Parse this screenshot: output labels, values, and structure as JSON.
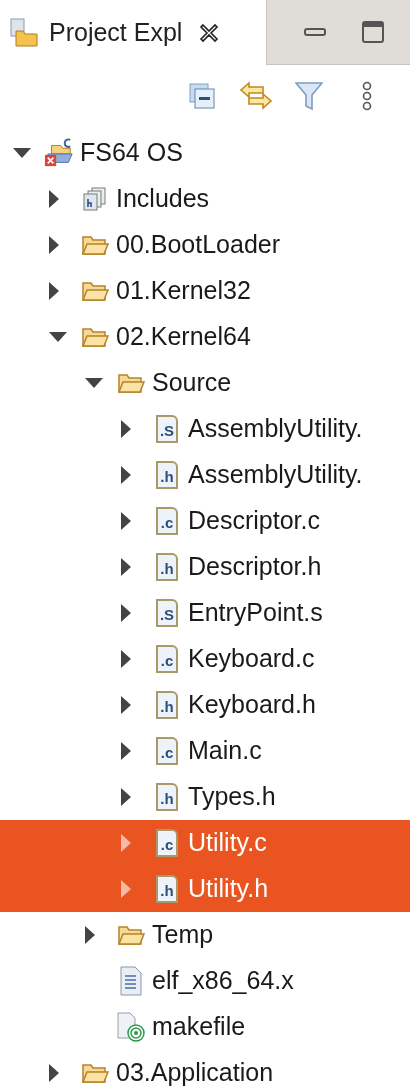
{
  "view_tab": {
    "title": "Project Expl",
    "selected": true
  },
  "tree": [
    {
      "label": "FS64 OS",
      "kind": "project",
      "expanded": true,
      "selected": false,
      "children": [
        {
          "label": "Includes",
          "kind": "includes",
          "expanded": false,
          "selected": false
        },
        {
          "label": "00.BootLoader",
          "kind": "folder",
          "expanded": false,
          "selected": false
        },
        {
          "label": "01.Kernel32",
          "kind": "folder",
          "expanded": false,
          "selected": false
        },
        {
          "label": "02.Kernel64",
          "kind": "folder",
          "expanded": true,
          "selected": false,
          "children": [
            {
              "label": "Source",
              "kind": "folder",
              "expanded": true,
              "selected": false,
              "children": [
                {
                  "label": "AssemblyUtility.",
                  "kind": "source",
                  "badge": ".S",
                  "expanded": false,
                  "selected": false
                },
                {
                  "label": "AssemblyUtility.",
                  "kind": "source",
                  "badge": ".h",
                  "expanded": false,
                  "selected": false
                },
                {
                  "label": "Descriptor.c",
                  "kind": "source",
                  "badge": ".c",
                  "expanded": false,
                  "selected": false
                },
                {
                  "label": "Descriptor.h",
                  "kind": "source",
                  "badge": ".h",
                  "expanded": false,
                  "selected": false
                },
                {
                  "label": "EntryPoint.s",
                  "kind": "source",
                  "badge": ".S",
                  "expanded": false,
                  "selected": false
                },
                {
                  "label": "Keyboard.c",
                  "kind": "source",
                  "badge": ".c",
                  "expanded": false,
                  "selected": false
                },
                {
                  "label": "Keyboard.h",
                  "kind": "source",
                  "badge": ".h",
                  "expanded": false,
                  "selected": false
                },
                {
                  "label": "Main.c",
                  "kind": "source",
                  "badge": ".c",
                  "expanded": false,
                  "selected": false
                },
                {
                  "label": "Types.h",
                  "kind": "source",
                  "badge": ".h",
                  "expanded": false,
                  "selected": false
                },
                {
                  "label": "Utility.c",
                  "kind": "source",
                  "badge": ".c",
                  "expanded": false,
                  "selected": true
                },
                {
                  "label": "Utility.h",
                  "kind": "source",
                  "badge": ".h",
                  "expanded": false,
                  "selected": true
                }
              ]
            },
            {
              "label": "Temp",
              "kind": "folder",
              "expanded": false,
              "selected": false
            },
            {
              "label": "elf_x86_64.x",
              "kind": "text",
              "selected": false
            },
            {
              "label": "makefile",
              "kind": "makefile",
              "selected": false
            }
          ]
        },
        {
          "label": "03.Application",
          "kind": "folder",
          "expanded": false,
          "selected": false
        }
      ]
    }
  ]
}
